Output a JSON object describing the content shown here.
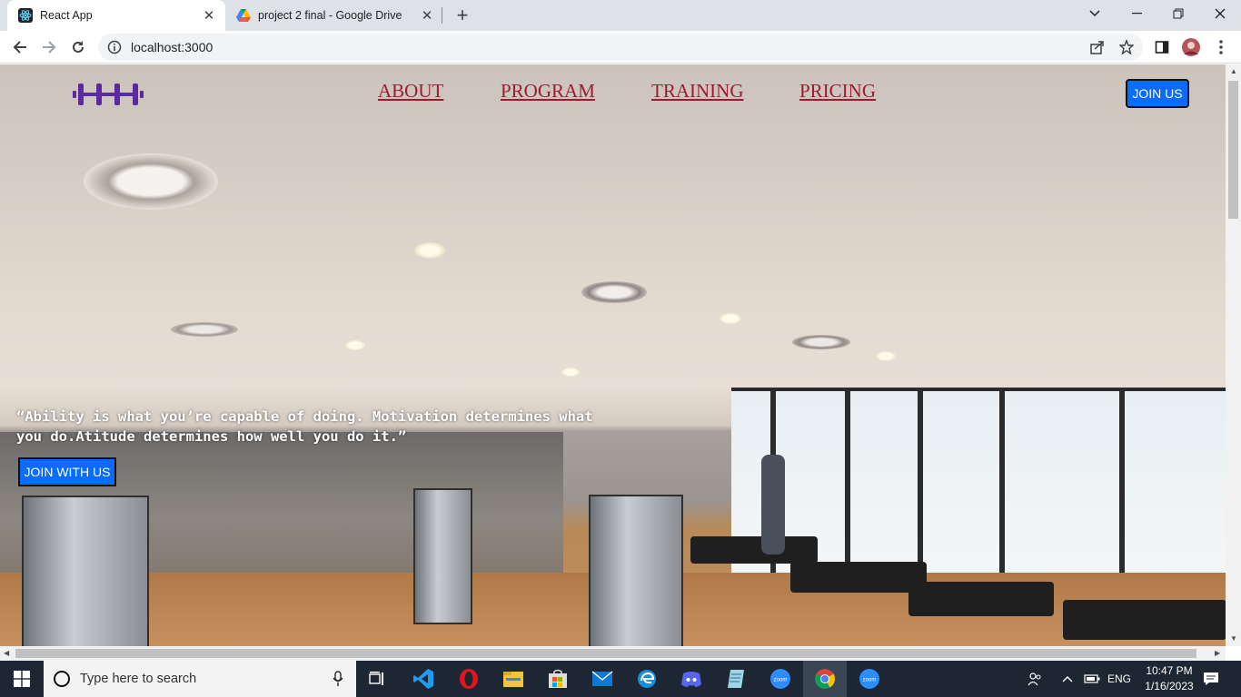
{
  "browser": {
    "tabs": [
      {
        "title": "React App",
        "active": true,
        "icon": "react-icon"
      },
      {
        "title": "project 2 final - Google Drive",
        "active": false,
        "icon": "google-drive-icon"
      }
    ],
    "url": "localhost:3000"
  },
  "page": {
    "nav": {
      "items": [
        "ABOUT",
        "PROGRAM",
        "TRAINING",
        "PRICING"
      ],
      "join_label": "JOIN US"
    },
    "hero": {
      "quote": "“Ability is what you’re capable of doing. Motivation determines what you do.Atitude determines how well you do it.”",
      "button_label": "JOIN WITH US"
    },
    "colors": {
      "nav_link": "#9b1c2f",
      "button": "#0a6cff",
      "logo": "#5b2aa0"
    }
  },
  "taskbar": {
    "search_placeholder": "Type here to search",
    "language": "ENG",
    "time": "10:47 PM",
    "date": "1/16/2023",
    "pinned": [
      "task-view-icon",
      "vscode-icon",
      "opera-icon",
      "file-explorer-icon",
      "microsoft-store-icon",
      "mail-icon",
      "edge-icon",
      "discord-icon",
      "notepad-icon",
      "zoom-icon",
      "chrome-icon",
      "zoom-icon"
    ]
  }
}
